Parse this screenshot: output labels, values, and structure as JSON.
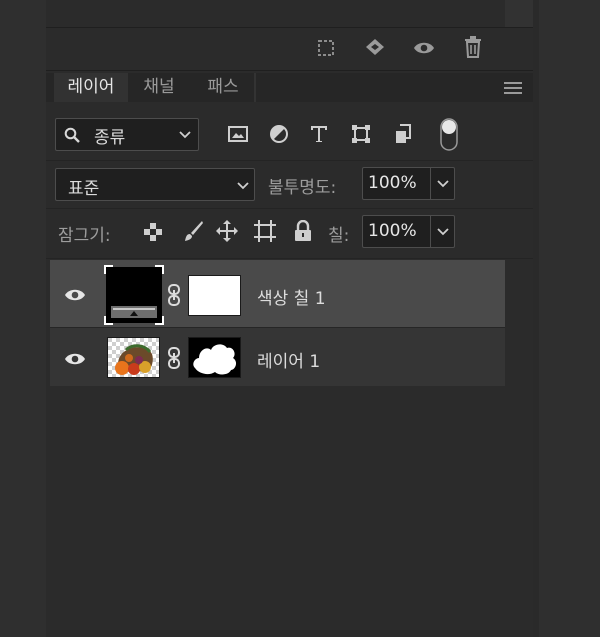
{
  "tabs": [
    "레이어",
    "채널",
    "패스"
  ],
  "filter": {
    "label": "종류"
  },
  "blend_mode": {
    "value": "표준"
  },
  "opacity": {
    "label": "불투명도:",
    "value": "100%"
  },
  "lock": {
    "label": "잠그기:"
  },
  "fill": {
    "label": "칠:",
    "value": "100%"
  },
  "layers": [
    {
      "name": "색상 칠 1",
      "selected": true,
      "visible": true
    },
    {
      "name": "레이어 1",
      "selected": false,
      "visible": true
    }
  ],
  "colors": {
    "panel_bg": "#2b2b2b",
    "selected_row": "#4a4a4a",
    "row": "#353535",
    "accent_text": "#e6e6e6"
  }
}
